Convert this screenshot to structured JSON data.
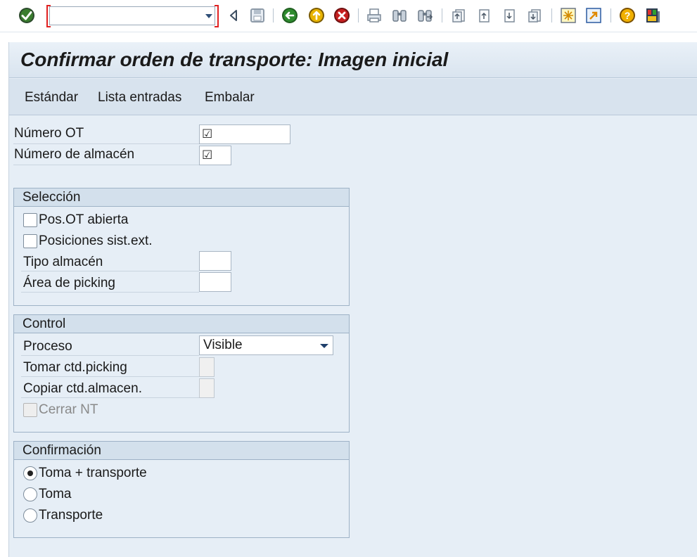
{
  "toolbar": {
    "command_field": {
      "value": "",
      "placeholder": ""
    },
    "icons": [
      "enter-icon",
      "back-arrow-icon",
      "save-icon",
      "back-icon",
      "exit-icon",
      "cancel-icon",
      "print-icon",
      "find-icon",
      "find-next-icon",
      "first-page-icon",
      "previous-page-icon",
      "next-page-icon",
      "last-page-icon",
      "create-session-icon",
      "shortcut-icon",
      "help-icon",
      "customize-layout-icon"
    ]
  },
  "title": "Confirmar orden de transporte: Imagen inicial",
  "menu": [
    "Estándar",
    "Lista entradas",
    "Embalar"
  ],
  "fields": {
    "numero_ot": {
      "label": "Número OT",
      "value": ""
    },
    "numero_almacen": {
      "label": "Número de almacén",
      "value": ""
    }
  },
  "seleccion": {
    "title": "Selección",
    "pos_ot_abierta": {
      "label": "Pos.OT abierta",
      "checked": false
    },
    "posiciones_sist_ext": {
      "label": "Posiciones sist.ext.",
      "checked": false
    },
    "tipo_almacen": {
      "label": "Tipo almacén",
      "value": ""
    },
    "area_picking": {
      "label": "Área de picking",
      "value": ""
    }
  },
  "control": {
    "title": "Control",
    "proceso": {
      "label": "Proceso",
      "value": "Visible"
    },
    "tomar_ctd_picking": {
      "label": "Tomar ctd.picking"
    },
    "copiar_ctd_almacen": {
      "label": "Copiar ctd.almacen."
    },
    "cerrar_nt": {
      "label": "Cerrar NT",
      "checked": false,
      "disabled": true
    }
  },
  "confirmacion": {
    "title": "Confirmación",
    "options": [
      "Toma + transporte",
      "Toma",
      "Transporte"
    ],
    "selected": "Toma + transporte"
  },
  "colors": {
    "background": "#e6eef6",
    "title_bar": "#dae5f0",
    "group_border": "#9eb2c6",
    "command_bracket": "#e02020"
  }
}
